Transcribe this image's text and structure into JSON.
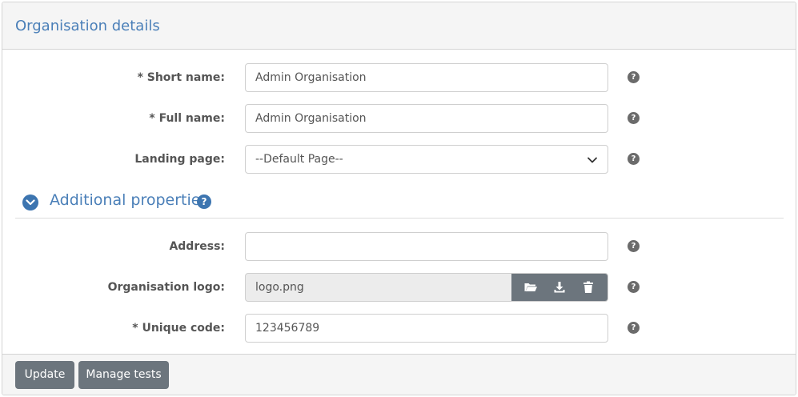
{
  "panel": {
    "title": "Organisation details"
  },
  "fields": {
    "short_name": {
      "label": "* Short name:",
      "value": "Admin Organisation"
    },
    "full_name": {
      "label": "* Full name:",
      "value": "Admin Organisation"
    },
    "landing_page": {
      "label": "Landing page:",
      "value": "--Default Page--"
    },
    "address": {
      "label": "Address:",
      "value": ""
    },
    "logo": {
      "label": "Organisation logo:",
      "value": "logo.png"
    },
    "unique_code": {
      "label": "* Unique code:",
      "value": "123456789"
    }
  },
  "section": {
    "title": "Additional properties",
    "help": "?"
  },
  "help_glyph": "?",
  "footer": {
    "update_label": "Update",
    "manage_tests_label": "Manage tests"
  },
  "colors": {
    "accent": "#4a7fb8",
    "button": "#6c757d",
    "help": "#6b6b6b"
  }
}
